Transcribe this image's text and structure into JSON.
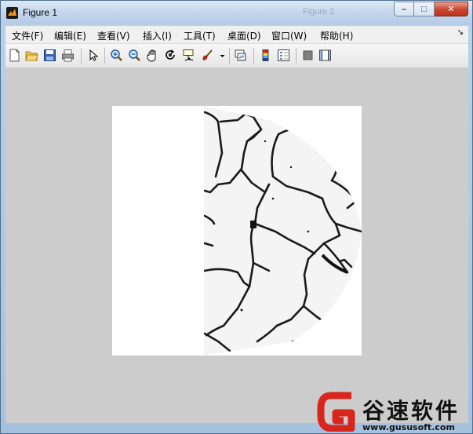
{
  "window": {
    "title": "Figure 1"
  },
  "background_titles": [
    "Figure 2"
  ],
  "menu": {
    "items": [
      "文件(F)",
      "编辑(E)",
      "查看(V)",
      "插入(I)",
      "工具(T)",
      "桌面(D)",
      "窗口(W)",
      "帮助(H)"
    ]
  },
  "toolbar": {
    "buttons": [
      "new-figure",
      "open-file",
      "save",
      "print",
      "edit-plot",
      "zoom-in",
      "zoom-out",
      "pan",
      "rotate-3d",
      "data-cursor",
      "brush",
      "brush-menu",
      "link-plot",
      "insert-colorbar",
      "insert-legend",
      "hide-plot-tools",
      "show-plot-tools"
    ]
  },
  "colors": {
    "figure_bg": "#cccccc",
    "accent_red": "#d9261c"
  },
  "watermark": {
    "brand": "谷速软件",
    "url": "www.gususoft.com"
  }
}
